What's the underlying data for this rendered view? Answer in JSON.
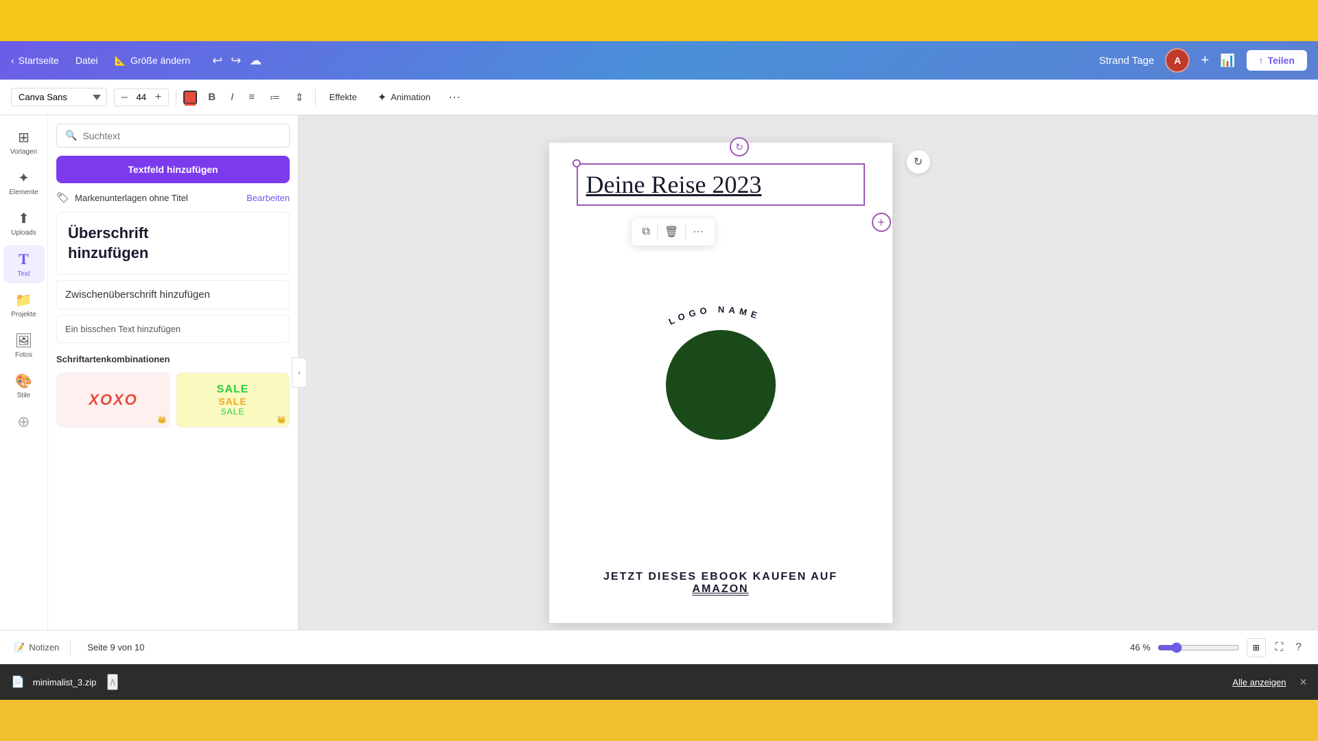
{
  "header": {
    "back_label": "Startseite",
    "file_label": "Datei",
    "resize_label": "Größe ändern",
    "resize_emoji": "📐",
    "project_title": "Strand Tage",
    "share_label": "Teilen",
    "undo_label": "↩",
    "redo_label": "↪",
    "cloud_label": "☁"
  },
  "toolbar": {
    "font_name": "Canva Sans",
    "font_size": "44",
    "decrease_label": "–",
    "increase_label": "+",
    "bold_label": "B",
    "italic_label": "I",
    "align_label": "≡",
    "list_label": "≔",
    "spacing_label": "⇕",
    "effects_label": "Effekte",
    "animation_label": "Animation",
    "more_label": "···"
  },
  "sidebar": {
    "icons": [
      {
        "id": "vorlagen",
        "label": "Vorlagen",
        "icon": "⊞"
      },
      {
        "id": "elemente",
        "label": "Elemente",
        "icon": "✦"
      },
      {
        "id": "uploads",
        "label": "Uploads",
        "icon": "⬆"
      },
      {
        "id": "text",
        "label": "Text",
        "icon": "T",
        "active": true
      },
      {
        "id": "projekte",
        "label": "Projekte",
        "icon": "📁"
      },
      {
        "id": "fotos",
        "label": "Fotos",
        "icon": "🖼"
      },
      {
        "id": "stile",
        "label": "Stile",
        "icon": "🎨"
      },
      {
        "id": "more2",
        "label": "",
        "icon": "⊕"
      }
    ],
    "search_placeholder": "Suchtext",
    "add_text_btn": "Textfeld hinzufügen",
    "brand_kit_label": "Markenunterlagen ohne Titel",
    "brand_edit_label": "Bearbeiten",
    "headline_label": "Überschrift\nhinzufügen",
    "subheadline_label": "Zwischenüberschrift hinzufügen",
    "body_label": "Ein bisschen Text hinzufügen",
    "font_combos_title": "Schriftartenkombinationen",
    "combo1_text": "XOXO",
    "combo2_lines": [
      "SALE",
      "SALE",
      "SALE"
    ]
  },
  "canvas": {
    "text_element": "Deine Reise 2023",
    "logo_name": "LOGO NAME",
    "bottom_text1": "JETZT DIESES EBOOK KAUFEN AUF",
    "bottom_text2": "AMAZON",
    "floating_toolbar": {
      "copy_icon": "⧉",
      "delete_icon": "🗑",
      "more_icon": "···"
    }
  },
  "bottom_bar": {
    "notes_label": "Notizen",
    "page_indicator": "Seite 9 von 10",
    "zoom_level": "46 %",
    "page_num": "10"
  },
  "download_bar": {
    "filename": "minimalist_3.zip",
    "view_all_label": "Alle anzeigen",
    "close_label": "×"
  },
  "colors": {
    "purple": "#7c3aed",
    "header_gradient_start": "#6c5ce7",
    "header_gradient_end": "#5b7fd4",
    "dark_green": "#1a4a1a",
    "yellow": "#f5c518"
  }
}
